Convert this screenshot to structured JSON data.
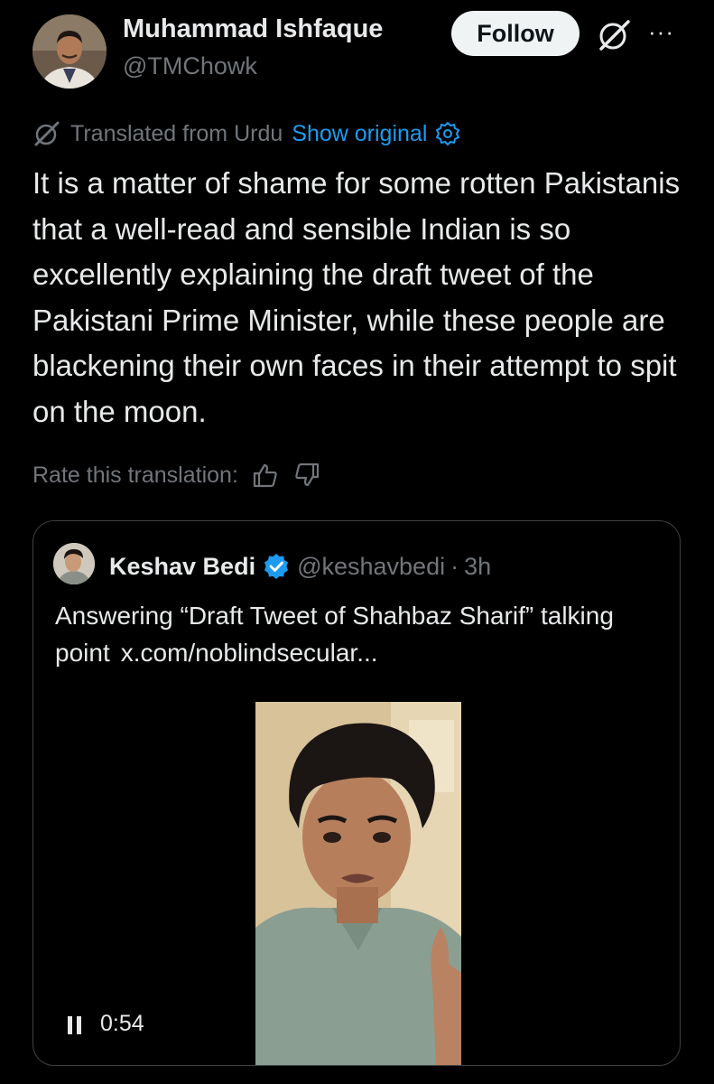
{
  "author": {
    "name": "Muhammad Ishfaque",
    "handle": "@TMChowk"
  },
  "actions": {
    "follow_label": "Follow",
    "grok_icon": "grok-icon",
    "more_icon": "more-icon",
    "more_label": "···"
  },
  "translation": {
    "label": "Translated from Urdu",
    "show_original": "Show original",
    "rate_label": "Rate this translation:"
  },
  "tweet": {
    "text": "It is a matter of shame for some rotten Pakistanis that a well-read and sensible Indian is so excellently explaining the draft tweet of the Pakistani Prime Minister, while these people are blackening their own faces in their attempt to spit on the moon."
  },
  "quote": {
    "name": "Keshav Bedi",
    "handle": "@keshavbedi",
    "separator": "·",
    "time": "3h",
    "text": "Answering “Draft Tweet of Shahbaz Sharif” talking point",
    "link": "x.com/noblindsecular...",
    "video_duration": "0:54"
  },
  "colors": {
    "background": "#000000",
    "text": "#e7e9ea",
    "muted": "#71767b",
    "accent": "#1d9bf0",
    "border": "#3d4144"
  }
}
